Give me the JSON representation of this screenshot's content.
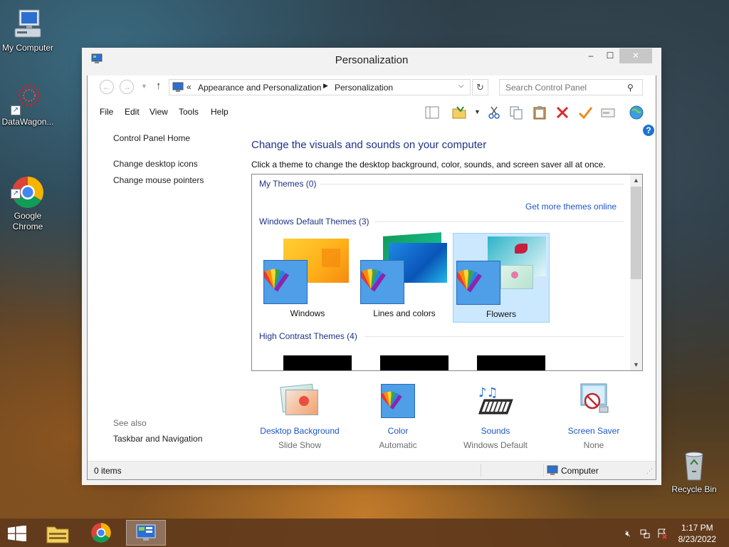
{
  "desktop": {
    "icons": [
      {
        "label": "My Computer"
      },
      {
        "label": "DataWagon..."
      },
      {
        "label": "Google\nChrome"
      },
      {
        "label": "Recycle Bin"
      }
    ]
  },
  "window": {
    "title": "Personalization",
    "nav": {
      "breadcrumb_prefix": "«",
      "breadcrumb": [
        "Appearance and Personalization",
        "Personalization"
      ],
      "search_placeholder": "Search Control Panel"
    },
    "menu": [
      "File",
      "Edit",
      "View",
      "Tools",
      "Help"
    ],
    "sidebar": {
      "home": "Control Panel Home",
      "links": [
        "Change desktop icons",
        "Change mouse pointers"
      ],
      "see_also_label": "See also",
      "see_also_links": [
        "Taskbar and Navigation"
      ]
    },
    "main": {
      "title": "Change the visuals and sounds on your computer",
      "description": "Click a theme to change the desktop background, color, sounds, and screen saver all at once.",
      "groups": {
        "my_themes": "My Themes (0)",
        "more_online": "Get more themes online",
        "default_themes": "Windows Default Themes (3)",
        "high_contrast": "High Contrast Themes (4)"
      },
      "themes": [
        {
          "name": "Windows",
          "selected": false
        },
        {
          "name": "Lines and colors",
          "selected": false
        },
        {
          "name": "Flowers",
          "selected": true
        }
      ],
      "bottom_items": [
        {
          "name": "Desktop Background",
          "value": "Slide Show"
        },
        {
          "name": "Color",
          "value": "Automatic"
        },
        {
          "name": "Sounds",
          "value": "Windows Default"
        },
        {
          "name": "Screen Saver",
          "value": "None"
        }
      ]
    },
    "status": {
      "items": "0 items",
      "location": "Computer"
    }
  },
  "taskbar": {
    "time": "1:17 PM",
    "date": "8/23/2022"
  },
  "colors": {
    "link": "#1e56c8",
    "heading": "#1e3287",
    "selection": "#cce8ff",
    "taskbar": "#5f3a1c"
  }
}
